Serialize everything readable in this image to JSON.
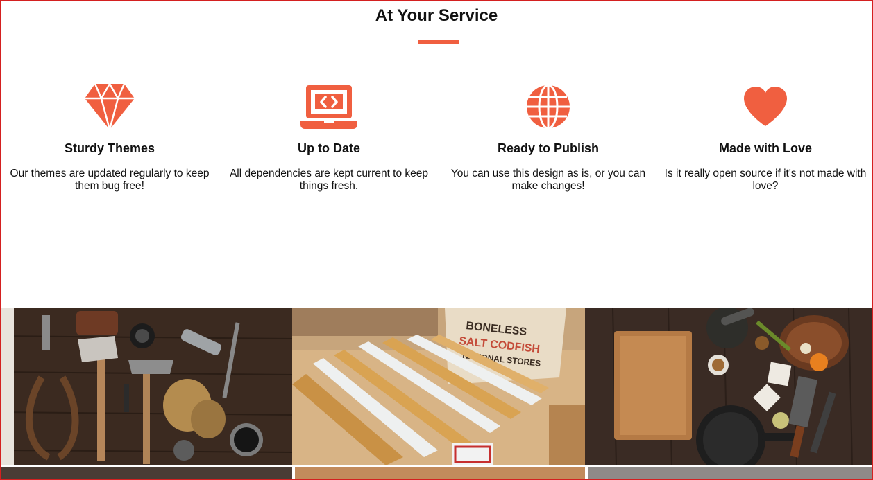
{
  "section": {
    "title": "At Your Service"
  },
  "services": [
    {
      "icon": "diamond-icon",
      "title": "Sturdy Themes",
      "text": "Our themes are updated regularly to keep them bug free!"
    },
    {
      "icon": "laptop-code-icon",
      "title": "Up to Date",
      "text": "All dependencies are kept current to keep things fresh."
    },
    {
      "icon": "globe-icon",
      "title": "Ready to Publish",
      "text": "You can use this design as is, or you can make changes!"
    },
    {
      "icon": "heart-icon",
      "title": "Made with Love",
      "text": "Is it really open source if it's not made with love?"
    }
  ],
  "gallery": {
    "photos": [
      {
        "name": "tools-photo",
        "label": ""
      },
      {
        "name": "rulers-photo",
        "label": "BONELESS SALT CODFISH NATIONAL STORES",
        "sign_line1": "BONELESS",
        "sign_line2": "SALT CODFISH",
        "sign_line3": "NATIONAL STORES"
      },
      {
        "name": "kitchen-photo",
        "label": ""
      }
    ]
  },
  "colors": {
    "accent": "#f05f40",
    "text": "#111111",
    "border": "#d42020"
  }
}
